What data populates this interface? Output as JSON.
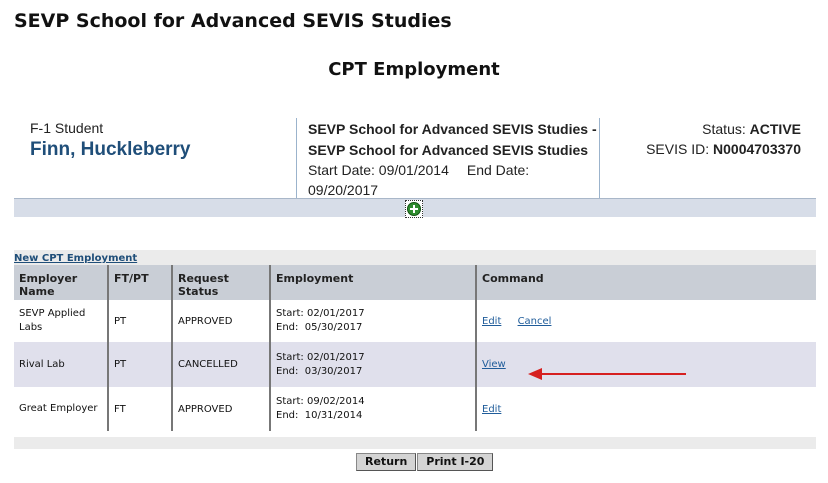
{
  "header": {
    "school_title": "SEVP School for Advanced SEVIS Studies",
    "page_title": "CPT Employment"
  },
  "student": {
    "type": "F-1 Student",
    "name": "Finn, Huckleberry",
    "school_line1": "SEVP School for Advanced SEVIS Studies -",
    "school_line2": "SEVP School for Advanced SEVIS Studies",
    "start_label": "Start Date: 09/01/2014",
    "end_label": "End Date:",
    "end_date": "09/20/2017",
    "status_label": "Status:",
    "status_value": "ACTIVE",
    "sevis_label": "SEVIS ID:",
    "sevis_value": "N0004703370"
  },
  "new_link": "New CPT Employment",
  "table": {
    "headers": {
      "employer": "Employer Name",
      "ftpt": "FT/PT",
      "status": "Request Status",
      "employment": "Employment",
      "command": "Command"
    },
    "rows": [
      {
        "employer": "SEVP Applied Labs",
        "ftpt": "PT",
        "status": "APPROVED",
        "start": "Start: 02/01/2017",
        "end": "End:  05/30/2017",
        "cmd1": "Edit",
        "cmd2": "Cancel"
      },
      {
        "employer": "Rival Lab",
        "ftpt": "PT",
        "status": "CANCELLED",
        "start": "Start: 02/01/2017",
        "end": "End:  03/30/2017",
        "cmd1": "View"
      },
      {
        "employer": "Great Employer",
        "ftpt": "FT",
        "status": "APPROVED",
        "start": "Start: 09/02/2014",
        "end": "End:  10/31/2014",
        "cmd1": "Edit"
      }
    ]
  },
  "buttons": {
    "return": "Return",
    "print": "Print I-20"
  },
  "colors": {
    "accent": "#1f4e79",
    "arrow": "#d62020",
    "expand_icon": "#2e8b2e"
  },
  "icons": {
    "expand": "plus-circle-icon",
    "annotation": "red-arrow-icon"
  }
}
